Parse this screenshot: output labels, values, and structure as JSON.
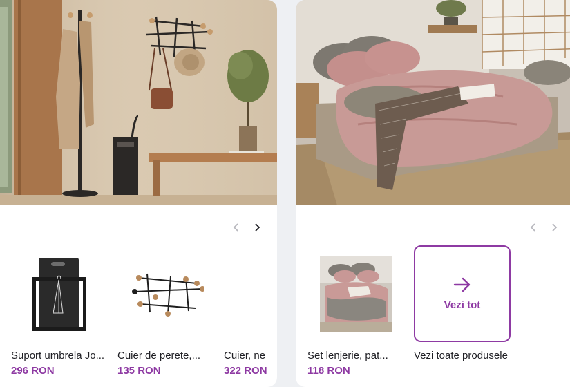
{
  "left_card": {
    "products": [
      {
        "name": "Suport umbrela Jo...",
        "price": "296 RON",
        "thumb_icon": "umbrella-stand-icon"
      },
      {
        "name": "Cuier de perete,...",
        "price": "135 RON",
        "thumb_icon": "wall-hook-rack-icon"
      },
      {
        "name": "Cuier, ne",
        "price": "322 RON",
        "thumb_icon": ""
      }
    ]
  },
  "right_card": {
    "products": [
      {
        "name": "Set lenjerie, pat...",
        "price": "118 RON",
        "thumb_icon": "bedding-set-icon"
      }
    ],
    "see_all": {
      "box_label": "Vezi tot",
      "caption": "Vezi toate produsele"
    }
  },
  "colors": {
    "accent": "#8e3aa3",
    "text": "#1f1f24",
    "nav_disabled": "#b7b7bd",
    "nav_active": "#1f1f24"
  }
}
